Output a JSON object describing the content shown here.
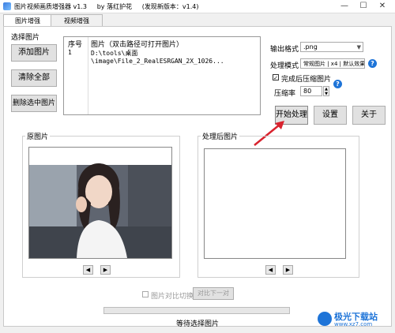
{
  "window": {
    "title": "图片视频画质增强器 v1.3",
    "author": "by 落红护花",
    "new_version": "(发现新版本：v1.4)",
    "min_btn": "—",
    "max_btn": "☐",
    "close_btn": "✕"
  },
  "tabs": [
    {
      "label": "图片增强",
      "active": true
    },
    {
      "label": "视频增强",
      "active": false
    }
  ],
  "select_section": {
    "title": "选择图片",
    "add_btn": "添加图片",
    "clear_btn": "清除全部",
    "remove_btn": "删除选中图片"
  },
  "file_list": {
    "headers": [
      "序号",
      "图片（双击路径可打开图片）"
    ],
    "rows": [
      {
        "index": "1",
        "path": "D:\\tools\\桌面\\image\\File_2_RealESRGAN_2X_1026..."
      }
    ]
  },
  "settings": {
    "output_format_label": "输出格式",
    "output_format_value": ".png",
    "process_mode_label": "处理模式",
    "process_mode_value": "常规图片 | x4 | 默认效果",
    "compress_after_label": "完成后压缩图片",
    "compress_after_checked": true,
    "compression_label": "压缩率",
    "compression_value": "80",
    "help_glyph": "?"
  },
  "actions": {
    "start_btn": "开始处理",
    "settings_btn": "设置",
    "about_btn": "关于"
  },
  "original_panel": {
    "title": "原图片"
  },
  "processed_panel": {
    "title": "处理后图片"
  },
  "nav": {
    "prev": "◀",
    "next": "▶"
  },
  "compare": {
    "toggle_label": "图片对比切换",
    "next_btn": "对比下一对"
  },
  "status": {
    "text": "等待选择图片"
  },
  "progress": {
    "value": 0
  },
  "watermark": {
    "brand": "极光下载站",
    "url": "www.xz7.com"
  },
  "colors": {
    "accent": "#1e74d8",
    "arrow": "#d9232e"
  }
}
